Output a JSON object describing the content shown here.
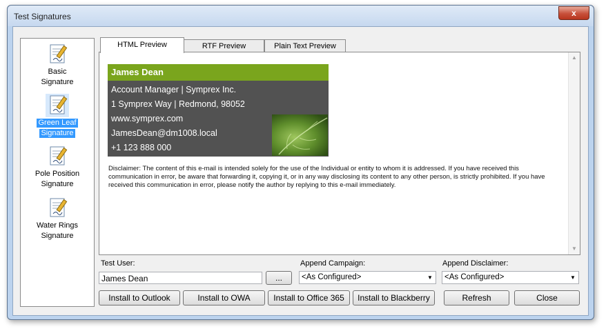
{
  "window": {
    "title": "Test Signatures",
    "close_glyph": "x"
  },
  "signatures": [
    {
      "line1": "Basic",
      "line2": "Signature",
      "selected": false
    },
    {
      "line1": "Green Leaf",
      "line2": "Signature",
      "selected": true
    },
    {
      "line1": "Pole Position",
      "line2": "Signature",
      "selected": false
    },
    {
      "line1": "Water Rings",
      "line2": "Signature",
      "selected": false
    }
  ],
  "tabs": [
    {
      "label": "HTML Preview",
      "active": true
    },
    {
      "label": "RTF Preview",
      "active": false
    },
    {
      "label": "Plain Text Preview",
      "active": false
    }
  ],
  "preview": {
    "name": "James Dean",
    "lines": [
      "Account Manager | Symprex Inc.",
      "1 Symprex Way | Redmond, 98052",
      "www.symprex.com",
      "JamesDean@dm1008.local",
      "+1 123 888 000"
    ],
    "disclaimer": "Disclaimer: The content of this e-mail is intended solely for the use of the Individual or entity to whom it is addressed. If you have received this communication in error, be aware that forwarding it, copying it, or in any way disclosing its content to any other person, is strictly prohibited. If you have received this communication in error, please notify the author by replying to this e-mail immediately.",
    "header_color": "#7aa51d",
    "card_color": "#525252"
  },
  "controls": {
    "test_user_label": "Test User:",
    "test_user_value": "James Dean",
    "browse_label": "...",
    "append_campaign_label": "Append Campaign:",
    "append_campaign_value": "<As Configured>",
    "append_disclaimer_label": "Append Disclaimer:",
    "append_disclaimer_value": "<As Configured>"
  },
  "buttons": {
    "install_outlook": "Install to Outlook",
    "install_owa": "Install to OWA",
    "install_office365": "Install to Office 365",
    "install_blackberry": "Install to Blackberry",
    "refresh": "Refresh",
    "close": "Close"
  }
}
